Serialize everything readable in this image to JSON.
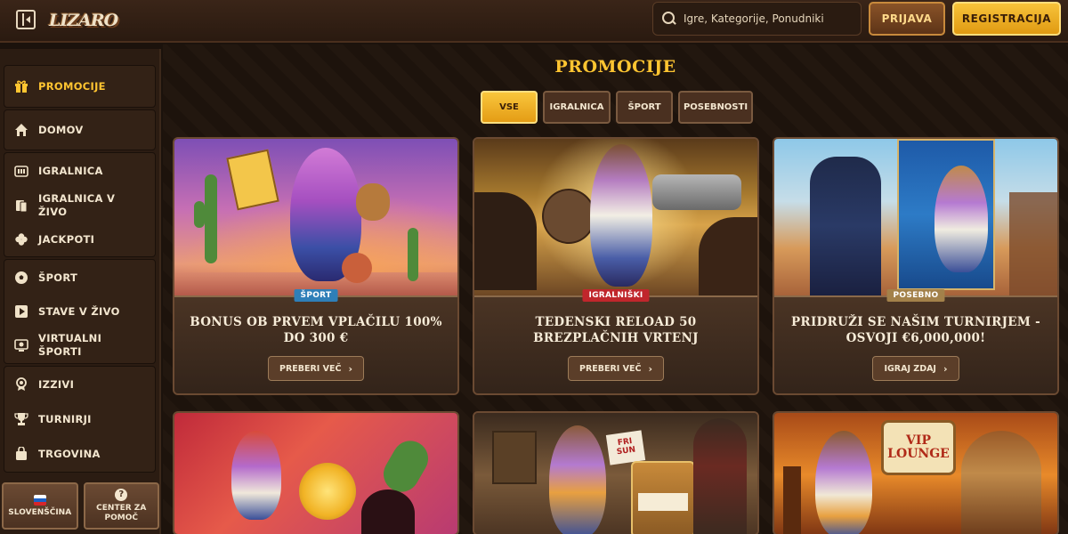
{
  "header": {
    "logo": "LIZARO",
    "search_placeholder": "Igre, Kategorije, Ponudniki",
    "login_label": "PRIJAVA",
    "register_label": "REGISTRACIJA"
  },
  "sidebar": {
    "items": [
      {
        "label": "PROMOCIJE",
        "icon": "gift-icon",
        "active": true
      },
      {
        "label": "DOMOV",
        "icon": "home-icon"
      },
      {
        "label": "IGRALNICA",
        "icon": "slot-machine-icon"
      },
      {
        "label": "IGRALNICA V ŽIVO",
        "icon": "live-cards-icon"
      },
      {
        "label": "JACKPOTI",
        "icon": "clover-icon"
      },
      {
        "label": "ŠPORT",
        "icon": "soccer-ball-icon"
      },
      {
        "label": "STAVE V ŽIVO",
        "icon": "play-icon"
      },
      {
        "label": "VIRTUALNI ŠPORTI",
        "icon": "virtual-sports-icon"
      },
      {
        "label": "IZZIVI",
        "icon": "medal-icon"
      },
      {
        "label": "TURNIRJI",
        "icon": "trophy-icon"
      },
      {
        "label": "TRGOVINA",
        "icon": "shopping-bag-icon"
      }
    ],
    "language_label": "SLOVENŠČINA",
    "help_label": "CENTER ZA POMOČ"
  },
  "main": {
    "title": "PROMOCIJE",
    "filters": [
      {
        "label": "VSE",
        "active": true
      },
      {
        "label": "IGRALNICA"
      },
      {
        "label": "ŠPORT"
      },
      {
        "label": "POSEBNOSTI"
      }
    ],
    "cards": [
      {
        "badge": "ŠPORT",
        "badge_color": "#2f7fb8",
        "title": "BONUS OB PRVEM VPLAČILU 100% DO 300 €",
        "button": "PREBERI VEČ"
      },
      {
        "badge": "IGRALNIŠKI",
        "badge_color": "#c0262c",
        "title": "TEDENSKI RELOAD 50 BREZPLAČNIH VRTENJ",
        "button": "PREBERI VEČ"
      },
      {
        "badge": "POSEBNO",
        "badge_color": "#a3814a",
        "title": "PRIDRUŽI SE NAŠIM TURNIRJEM - OSVOJI €6,000,000!",
        "button": "IGRAJ ZDAJ"
      }
    ],
    "bottom_card_texts": [
      "FRI SUN",
      "VIP LOUNGE"
    ]
  },
  "colors": {
    "accent_gold": "#ffc531",
    "background": "#1b120c",
    "sidebar": "#2b1c12"
  }
}
